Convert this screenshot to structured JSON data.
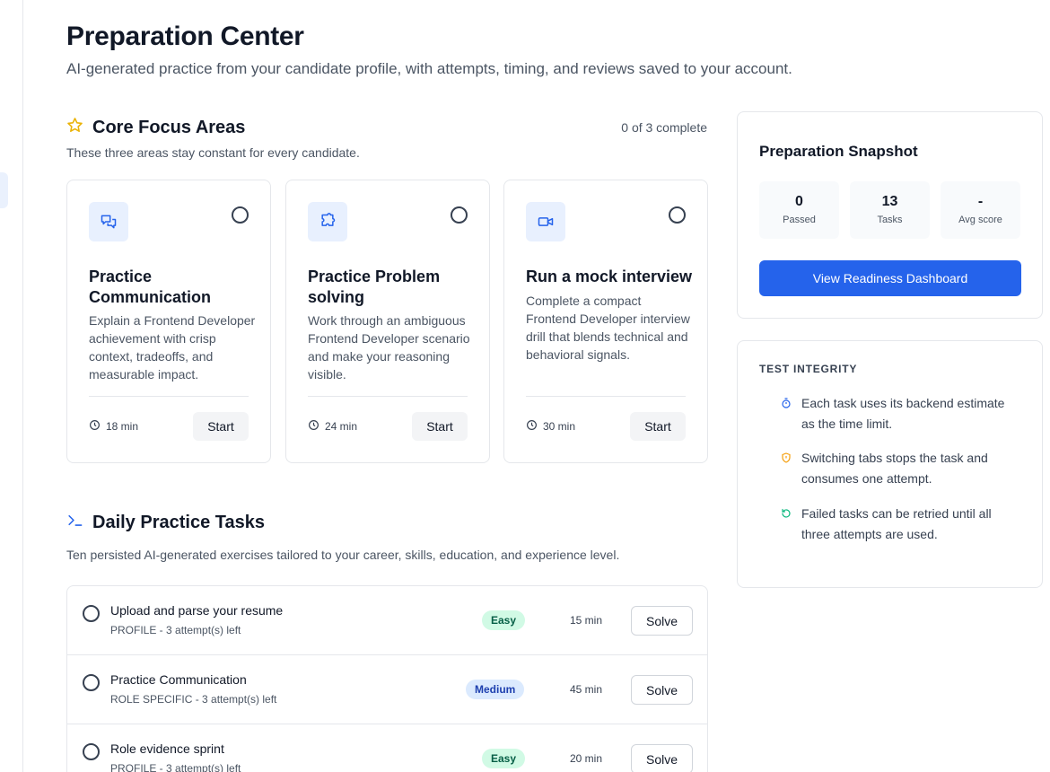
{
  "page": {
    "title": "Preparation Center",
    "subtitle": "AI-generated practice from your candidate profile, with attempts, timing, and reviews saved to your account."
  },
  "core": {
    "title": "Core Focus Areas",
    "description": "These three areas stay constant for every candidate.",
    "progress": "0 of 3 complete",
    "cards": [
      {
        "title": "Practice Communication",
        "description": "Explain a Frontend Developer achievement with crisp context, tradeoffs, and measurable impact.",
        "time": "18 min",
        "button": "Start",
        "icon": "chat-icon"
      },
      {
        "title": "Practice Problem solving",
        "description": "Work through an ambiguous Frontend Developer scenario and make your reasoning visible.",
        "time": "24 min",
        "button": "Start",
        "icon": "puzzle-icon"
      },
      {
        "title": "Run a mock interview",
        "description": "Complete a compact Frontend Developer interview drill that blends technical and behavioral signals.",
        "time": "30 min",
        "button": "Start",
        "icon": "video-icon"
      }
    ]
  },
  "daily": {
    "title": "Daily Practice Tasks",
    "description": "Ten persisted AI-generated exercises tailored to your career, skills, education, and experience level.",
    "tasks": [
      {
        "title": "Upload and parse your resume",
        "meta": "PROFILE - 3 attempt(s) left",
        "difficulty": "Easy",
        "time": "15 min",
        "button": "Solve"
      },
      {
        "title": "Practice Communication",
        "meta": "ROLE SPECIFIC - 3 attempt(s) left",
        "difficulty": "Medium",
        "time": "45 min",
        "button": "Solve"
      },
      {
        "title": "Role evidence sprint",
        "meta": "PROFILE - 3 attempt(s) left",
        "difficulty": "Easy",
        "time": "20 min",
        "button": "Solve"
      }
    ]
  },
  "snapshot": {
    "title": "Preparation Snapshot",
    "stats": [
      {
        "value": "0",
        "label": "Passed"
      },
      {
        "value": "13",
        "label": "Tasks"
      },
      {
        "value": "-",
        "label": "Avg score"
      }
    ],
    "button": "View Readiness Dashboard"
  },
  "integrity": {
    "title": "TEST INTEGRITY",
    "items": [
      {
        "text": "Each task uses its backend estimate as the time limit.",
        "icon": "timer-icon",
        "color": "#2563eb"
      },
      {
        "text": "Switching tabs stops the task and consumes one attempt.",
        "icon": "shield-icon",
        "color": "#f59e0b"
      },
      {
        "text": "Failed tasks can be retried until all three attempts are used.",
        "icon": "retry-icon",
        "color": "#10b981"
      }
    ]
  },
  "colors": {
    "accent": "#2563eb",
    "star": "#eab308"
  }
}
